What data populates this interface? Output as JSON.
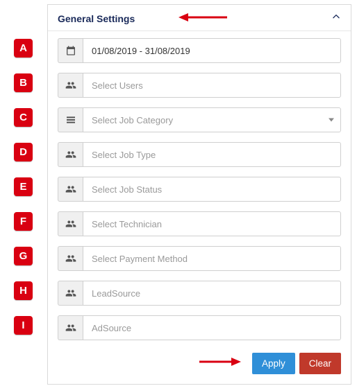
{
  "header": {
    "title": "General Settings"
  },
  "fields": {
    "date_range": "01/08/2019 - 31/08/2019",
    "users_placeholder": "Select Users",
    "job_category_placeholder": "Select Job Category",
    "job_type_placeholder": "Select Job Type",
    "job_status_placeholder": "Select Job Status",
    "technician_placeholder": "Select Technician",
    "payment_method_placeholder": "Select Payment Method",
    "lead_source_placeholder": "LeadSource",
    "ad_source_placeholder": "AdSource"
  },
  "actions": {
    "apply_label": "Apply",
    "clear_label": "Clear"
  },
  "annotation_labels": [
    "A",
    "B",
    "C",
    "D",
    "E",
    "F",
    "G",
    "H",
    "I"
  ],
  "colors": {
    "accent": "#2f8fd8",
    "danger": "#c0392b",
    "badge": "#d90011",
    "title": "#1a2a5a"
  }
}
